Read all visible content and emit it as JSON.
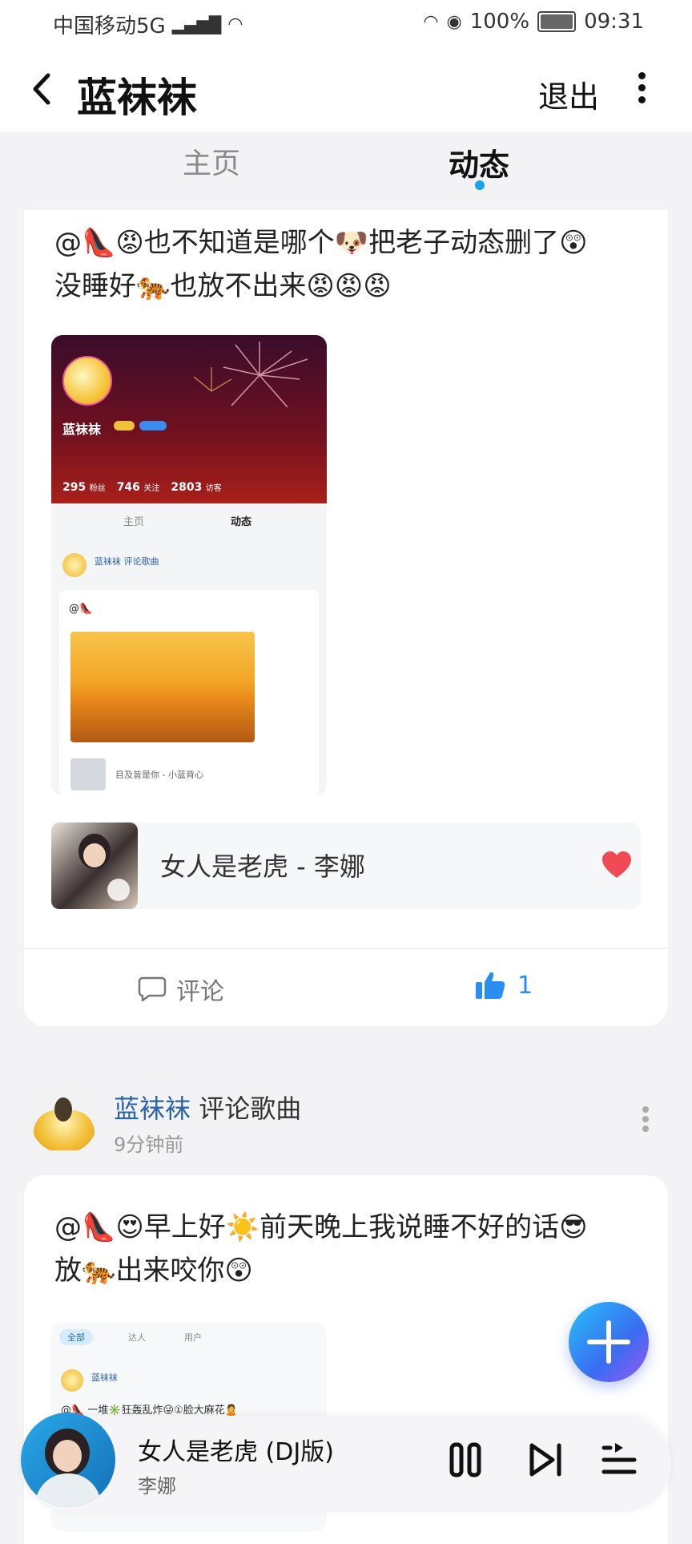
{
  "status_bar": {
    "carrier": "中国移动5G",
    "battery": "100%",
    "time": "09:31"
  },
  "header": {
    "title": "蓝袜袜",
    "logout": "退出"
  },
  "tabs": {
    "home": "主页",
    "feed": "动态",
    "active": "动态"
  },
  "post1": {
    "text_line1": "@👠😡也不知道是哪个🐶把老子动态删了😲",
    "text_line2": "没睡好🐅也放不出来😡😡😡",
    "screenshot": {
      "name": "蓝袜袜",
      "stat1_value": "295",
      "stat1_label": "粉丝",
      "stat2_value": "746",
      "stat2_label": "关注",
      "stat3_value": "2803",
      "stat3_label": "访客",
      "tab_home": "主页",
      "tab_feed": "动态",
      "inner_author": "蓝袜袜 评论歌曲",
      "inner_text": "@👠",
      "inner_song": "目及皆是你 - 小蓝背心"
    },
    "song": "女人是老虎 - 李娜",
    "comment_label": "评论",
    "like_count": "1"
  },
  "post2": {
    "author": "蓝袜袜",
    "action": "评论歌曲",
    "time": "9分钟前",
    "text_line1": "@👠😍早上好☀️前天晚上我说睡不好的话😎",
    "text_line2": "放🐅出来咬你😲",
    "screenshot": {
      "tab_all": "全部",
      "tab_talent": "达人",
      "tab_user": "用户",
      "inner_author": "蓝袜袜",
      "inner_line": "@👠 一堆✳️狂轰乱炸😜①脸大麻花🙎"
    }
  },
  "player": {
    "title": "女人是老虎 (DJ版)",
    "artist": "李娜"
  },
  "colors": {
    "accent": "#1aa1f0",
    "like_blue": "#2a8ef0",
    "heart_red": "#f04b55",
    "author_link": "#2b63a8"
  },
  "icons": [
    "back-icon",
    "more-vertical-icon",
    "comment-icon",
    "thumbs-up-icon",
    "heart-icon",
    "plus-icon",
    "pause-icon",
    "skip-next-icon",
    "playlist-icon"
  ]
}
